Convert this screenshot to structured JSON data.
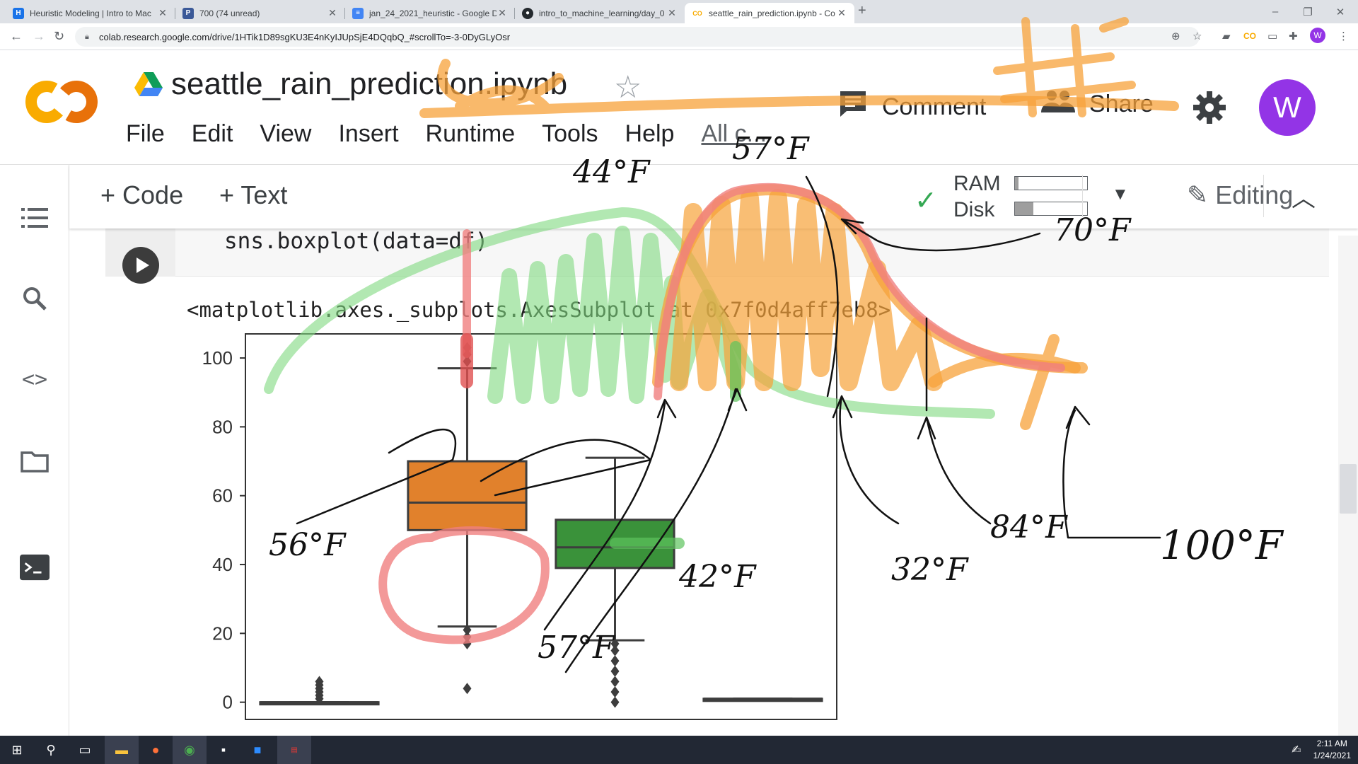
{
  "browser": {
    "tabs": [
      {
        "title": "Heuristic Modeling | Intro to Mac",
        "favicon_color": "#1a73e8"
      },
      {
        "title": "700 (74 unread)",
        "favicon_color": "#3b5998"
      },
      {
        "title": "jan_24_2021_heuristic - Google D",
        "favicon_color": "#4285f4"
      },
      {
        "title": "intro_to_machine_learning/day_0",
        "favicon_color": "#24292e"
      },
      {
        "title": "seattle_rain_prediction.ipynb - Co",
        "favicon_color": "#f9ab00"
      }
    ],
    "url": "colab.research.google.com/drive/1HTik1D89sgKU3E4nKyIJUpSjE4DQqbQ_#scrollTo=-3-0DyGLyOsr",
    "profile_letter": "W"
  },
  "colab": {
    "notebook_title": "seattle_rain_prediction.ipynb",
    "menu": [
      "File",
      "Edit",
      "View",
      "Insert",
      "Runtime",
      "Tools",
      "Help"
    ],
    "menu_extra": "All c...",
    "comment_label": "Comment",
    "share_label": "Share",
    "avatar_letter": "W",
    "add_code_label": "+ Code",
    "add_text_label": "+ Text",
    "ram_label": "RAM",
    "disk_label": "Disk",
    "ram_usage": 0.05,
    "disk_usage": 0.25,
    "editing_label": "Editing"
  },
  "cell": {
    "code": "sns.boxplot(data=df)",
    "output": "<matplotlib.axes._subplots.AxesSubplot at 0x7f0d4aff7eb8>"
  },
  "chart_data": {
    "type": "boxplot",
    "y_ticks": [
      0,
      20,
      40,
      60,
      80,
      100
    ],
    "ylim": [
      -5,
      107
    ],
    "boxes": [
      {
        "color": "#3274a1",
        "whisker_low": 0,
        "q1": 0,
        "median": 0,
        "q3": 0,
        "whisker_high": 0,
        "outliers": [
          1,
          2,
          3,
          4,
          5,
          6
        ]
      },
      {
        "color": "#e1812c",
        "whisker_low": 22,
        "q1": 50,
        "median": 58,
        "q3": 70,
        "whisker_high": 97,
        "outliers": [
          4,
          17,
          19,
          21,
          99,
          101,
          103
        ]
      },
      {
        "color": "#3a923a",
        "whisker_low": 18,
        "q1": 39,
        "median": 45,
        "q3": 53,
        "whisker_high": 71,
        "outliers": [
          0,
          3,
          6,
          9,
          12,
          15,
          17
        ]
      },
      {
        "color": "#c03d3e",
        "whisker_low": 1,
        "q1": 1,
        "median": 1,
        "q3": 1,
        "whisker_high": 1,
        "outliers": []
      }
    ],
    "annotations": [
      "44°F",
      "57°F",
      "70°F",
      "56°F",
      "42°F",
      "57°F",
      "32°F",
      "84°F",
      "100°F"
    ]
  },
  "taskbar": {
    "time": "2:11 AM",
    "date": "1/24/2021"
  }
}
